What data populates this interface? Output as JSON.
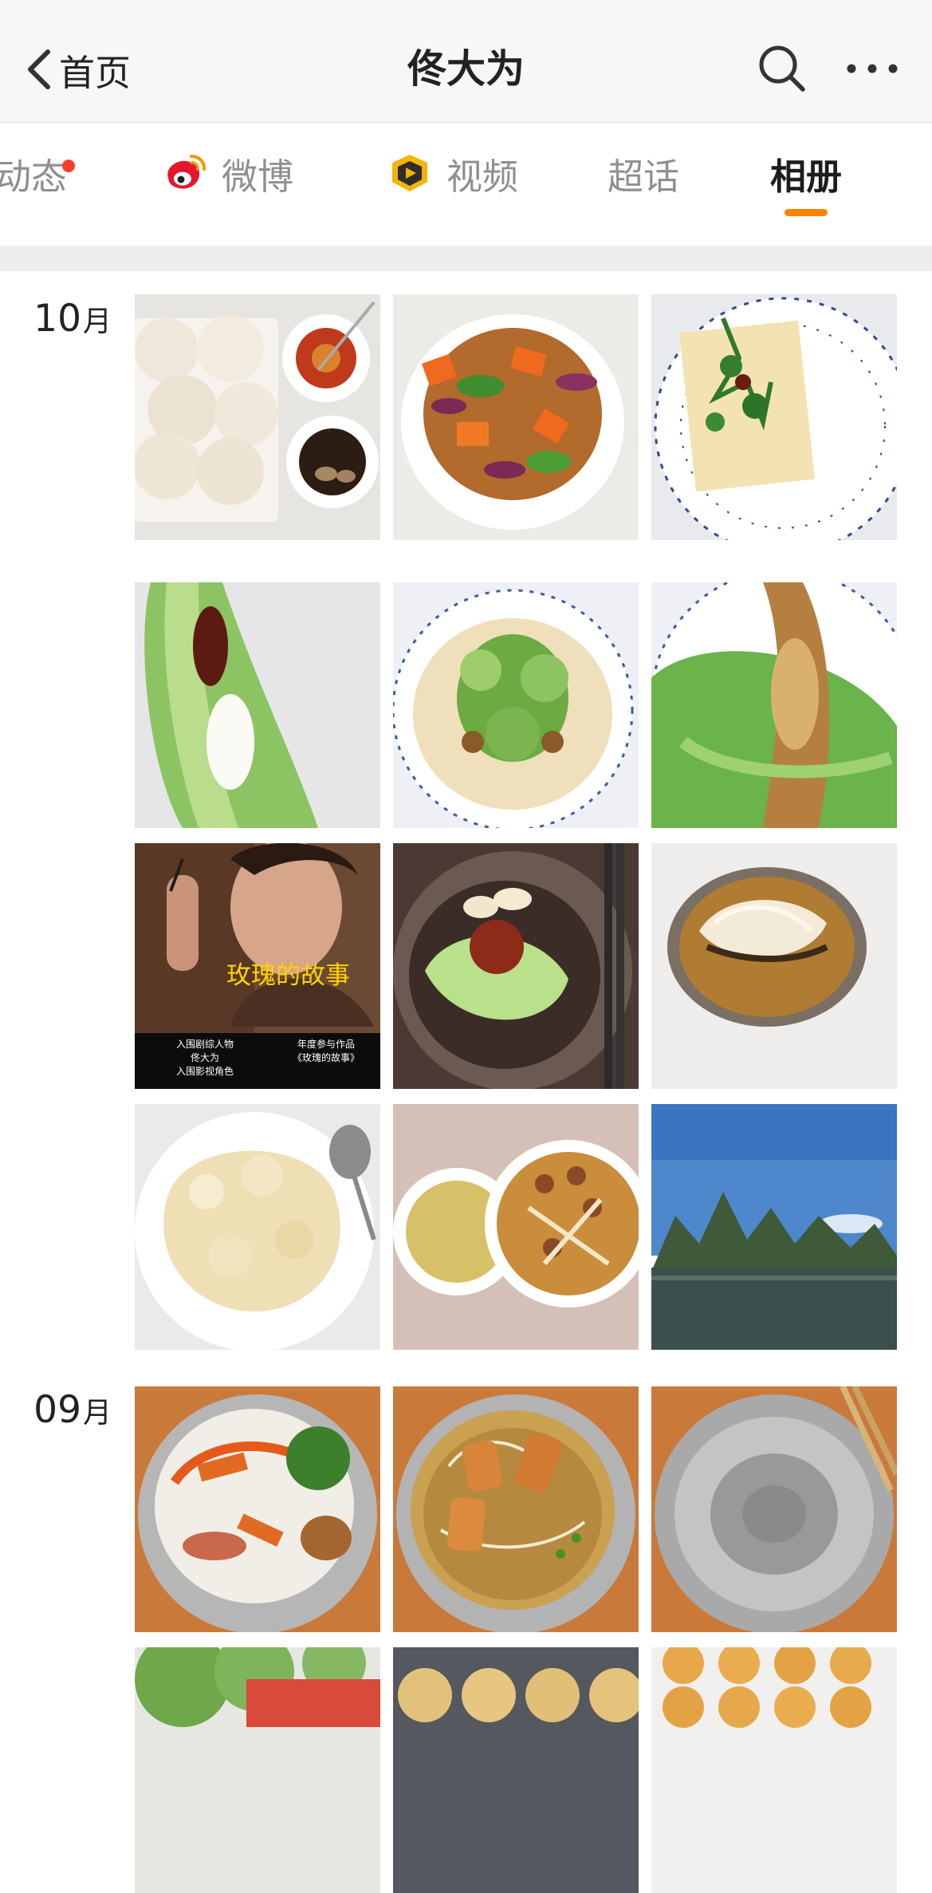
{
  "header": {
    "back_label": "首页",
    "title": "佟大为",
    "icons": [
      "chevron-left-icon",
      "search-icon",
      "more-icon"
    ]
  },
  "tabs": [
    {
      "label": "动态",
      "has_badge": true
    },
    {
      "label": "微博",
      "icon": "weibo-icon"
    },
    {
      "label": "视频",
      "icon": "video-icon"
    },
    {
      "label": "超话"
    },
    {
      "label": "相册",
      "active": true
    }
  ],
  "accent_color": "#ff8200",
  "badge_color": "#ff3b30",
  "albums": [
    {
      "month": "10",
      "unit": "月",
      "photo_count": 12
    },
    {
      "month": "09",
      "unit": "月"
    }
  ],
  "poster": {
    "title": "玫瑰的故事",
    "caption_left": [
      "入围剧综人物",
      "佟大为",
      "入围影视角色"
    ],
    "caption_right": [
      "年度参与作品",
      "《玫瑰的故事》"
    ]
  }
}
